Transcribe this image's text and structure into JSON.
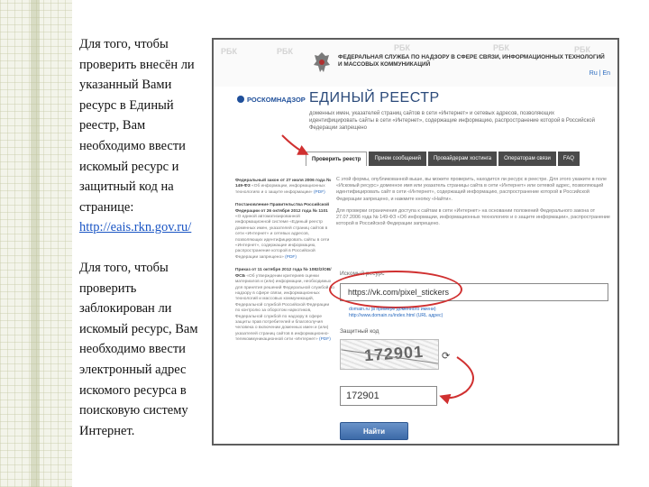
{
  "slide": {
    "paragraph1": "Для того, чтобы проверить внесён ли указанный Вами ресурс в Единый реестр, Вам необходимо ввести искомый ресурс и защитный код на странице:",
    "link": "http://eais.rkn.gov.ru/",
    "paragraph2": "Для того, чтобы проверить заблокирован ли искомый ресурс, Вам необходимо ввести электронный адрес искомого ресурса в поисковую систему Интернет."
  },
  "screenshot": {
    "watermark": "РБК",
    "agency_name": "Федеральная служба по надзору в сфере связи, информационных технологий и массовых коммуникаций",
    "lang": {
      "ru": "Ru",
      "en": "En",
      "sep": " | "
    },
    "logo_text": "РОСКОМНАДЗОР",
    "title": "ЕДИНЫЙ РЕЕСТР",
    "description": "доменных имен, указателей страниц сайтов в сети «Интернет» и сетевых адресов, позволяющих идентифицировать сайты в сети «Интернет», содержащие информацию, распространение которой в Российской Федерации запрещено",
    "tabs": [
      "Проверить реестр",
      "Прием сообщений",
      "Провайдерам хостинга",
      "Операторам связи",
      "FAQ"
    ],
    "side_blocks": [
      {
        "heading": "Федеральный закон от 27 июля 2006 года № 149-ФЗ",
        "text": "«Об информации, информационных технологиях и о защите информации»",
        "link": "(PDF)"
      },
      {
        "heading": "Постановление Правительства Российской Федерации от 26 октября 2012 года № 1101",
        "text": "«О единой автоматизированной информационной системе «Единый реестр доменных имен, указателей страниц сайтов в сети «Интернет» и сетевых адресов, позволяющих идентифицировать сайты в сети «Интернет», содержащие информацию, распространение которой в Российской Федерации запрещено»",
        "link": "(PDF)"
      },
      {
        "heading": "Приказ от 11 октября 2012 года № 1082/2/ОВ/ФСБ",
        "text": "«Об утверждении критериев оценки материалов и (или) информации, необходимых для принятия решений Федеральной службой по надзору в сфере связи, информационных технологий и массовых коммуникаций, Федеральной службой Российской Федерации по контролю за оборотом наркотиков, Федеральной службой по надзору в сфере защиты прав потребителей и благополучия человека о включении доменных имен и (или) указателей страниц сайтов в информационно-телекоммуникационной сети «Интернет»",
        "link": "(PDF)"
      }
    ],
    "main_paragraphs": [
      "С этой формы, опубликованной выше, вы можете проверить, находится ли ресурс в реестре. Для этого укажите в поле «Искомый ресурс» доменное имя или указатель страницы сайта в сети «Интернет» или сетевой адрес, позволяющий идентифицировать сайт в сети «Интернет», содержащий информацию, распространение которой в Российской Федерации запрещено, и нажмите кнопку «Найти».",
      "Для проверки ограничения доступа к сайтам в сети «Интернет» на основании положений Федерального закона от 27.07.2006 года № 149-ФЗ «Об информации, информационных технологиях и о защите информации», распространение которой в Российской Федерации запрещено."
    ],
    "resource_label": "Искомый ресурс",
    "resource_value": "https://vk.com/pixel_stickers",
    "examples": [
      "domain.ru (в примере доменного имени)",
      "http://www.domain.ru/index.html (URL адрес)"
    ],
    "captcha_label": "Защитный код",
    "captcha_text": "172901",
    "captcha_value": "172901",
    "find_button": "Найти",
    "colors": {
      "annotation": "#d03030",
      "button": "#3c6aa8",
      "tab_dark": "#4a4a4a"
    }
  }
}
